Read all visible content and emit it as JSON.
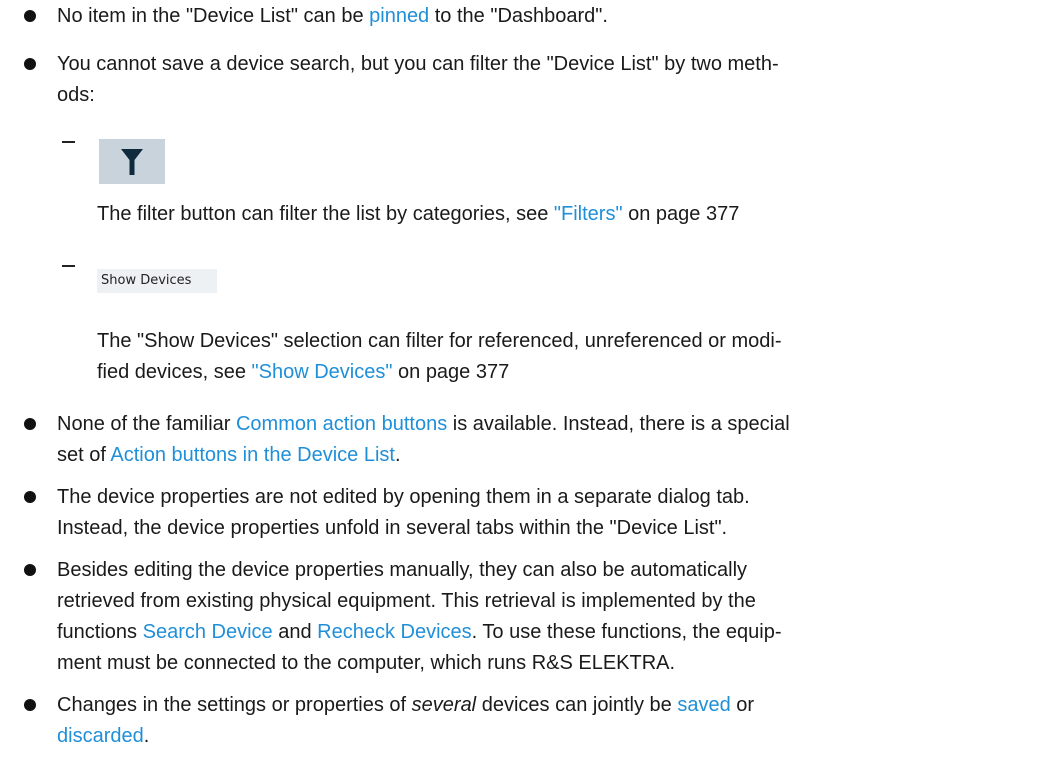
{
  "items": [
    {
      "p1": "No item in the \"Device List\" can be ",
      "l1": "pinned",
      "p2": " to the \"Dashboard\"."
    },
    {
      "line1": "You cannot save a device search, but you can filter the \"Device List\" by two meth-",
      "line2": "ods:"
    },
    {
      "p1": "None of the familiar ",
      "l1": "Common action buttons",
      "p2": " is available. Instead, there is a special",
      "p3": "set of ",
      "l2": "Action buttons in the Device List",
      "p4": "."
    },
    {
      "line1": "The device properties are not edited by opening them in a separate dialog tab.",
      "line2": "Instead, the device properties unfold in several tabs within the \"Device List\"."
    },
    {
      "line1": "Besides editing the device properties manually, they can also be automatically",
      "line2": "retrieved from existing physical equipment. This retrieval is implemented by the",
      "p1": "functions ",
      "l1": "Search Device",
      "p2": " and ",
      "l2": "Recheck Devices",
      "p3": ". To use these functions, the equip-",
      "line4": "ment must be connected to the computer, which runs R&S ELEKTRA."
    },
    {
      "p1": "Changes in the settings or properties of ",
      "em": "several",
      "p2": " devices can jointly be ",
      "l1": "saved",
      "p3": " or",
      "l2": "discarded",
      "p4": "."
    }
  ],
  "filter": {
    "icon": "filter-funnel-icon",
    "desc_text": "The filter button can filter the list by categories, see ",
    "desc_link": "\"Filters\"",
    "desc_page": " on page 377"
  },
  "show_devices": {
    "button_label": "Show Devices",
    "desc_line1": "The \"Show Devices\" selection can filter for referenced, unreferenced or modi-",
    "desc_line2_text": "fied devices, see ",
    "desc_link": "\"Show Devices\"",
    "desc_page": " on page 377"
  },
  "colors": {
    "link": "#1f8fd8",
    "filter_button_bg": "#c8d3dc",
    "filter_icon": "#0f2a3c"
  }
}
